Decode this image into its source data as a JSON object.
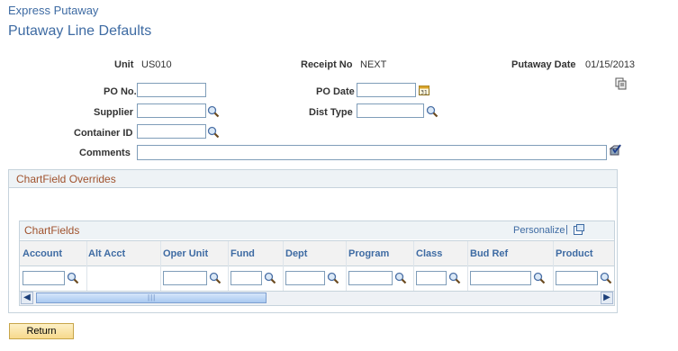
{
  "header": {
    "breadcrumb": "Express Putaway",
    "title": "Putaway Line Defaults"
  },
  "info": {
    "unit_label": "Unit",
    "unit_value": "US010",
    "receipt_label": "Receipt No",
    "receipt_value": "NEXT",
    "putaway_date_label": "Putaway Date",
    "putaway_date_value": "01/15/2013"
  },
  "form": {
    "po_no_label": "PO No.",
    "po_no_value": "",
    "po_date_label": "PO Date",
    "po_date_value": "",
    "supplier_label": "Supplier",
    "supplier_value": "",
    "dist_type_label": "Dist Type",
    "dist_type_value": "",
    "container_id_label": "Container ID",
    "container_id_value": "",
    "comments_label": "Comments",
    "comments_value": ""
  },
  "chartfield_overrides": {
    "title": "ChartField Overrides",
    "grid": {
      "title": "ChartFields",
      "personalize": "Personalize",
      "columns": [
        "Account",
        "Alt Acct",
        "Oper Unit",
        "Fund",
        "Dept",
        "Program",
        "Class",
        "Bud Ref",
        "Product"
      ]
    }
  },
  "actions": {
    "return_label": "Return"
  },
  "icons": {
    "lookup": "magnifier-lookup-icon",
    "calendar": "calendar-icon",
    "copy": "copy-icon",
    "spellcheck": "spellcheck-icon",
    "new_window": "new-window-icon"
  },
  "colors": {
    "link_blue": "#3e6ba3",
    "section_title": "#a0522d",
    "button_gold": "#f7d98c"
  }
}
